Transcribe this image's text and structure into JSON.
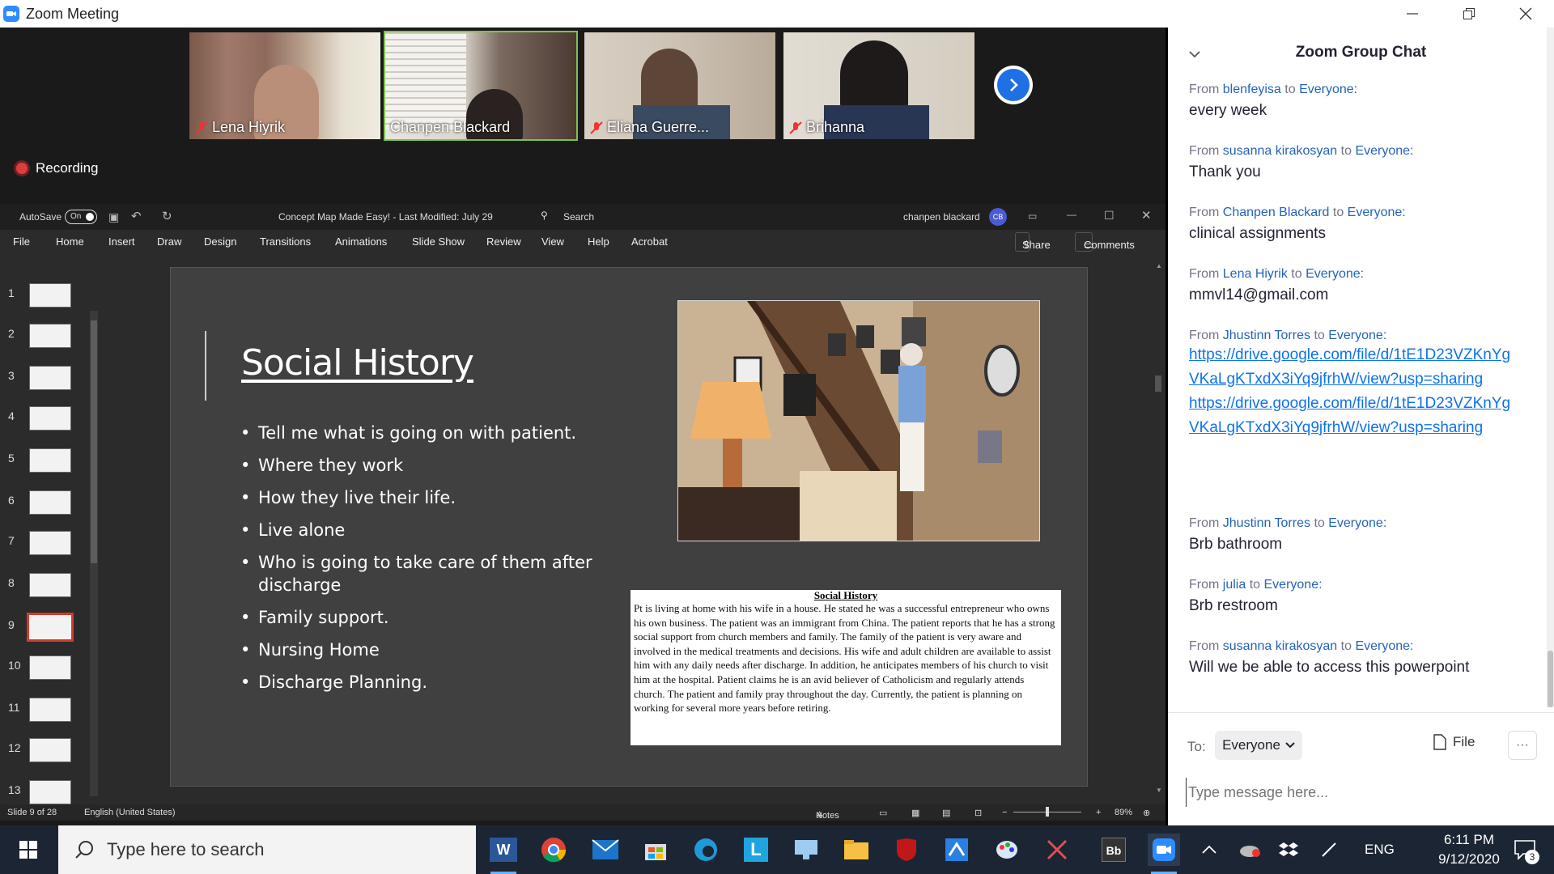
{
  "window": {
    "title": "Zoom Meeting"
  },
  "participants": [
    {
      "name": "Lena Hiyrik",
      "muted": true
    },
    {
      "name": "Chanpen Blackard",
      "muted": false,
      "active": true
    },
    {
      "name": "Eliana Guerre...",
      "muted": true
    },
    {
      "name": "Brihanna",
      "muted": true
    }
  ],
  "recording": "Recording",
  "ppt": {
    "autosave": "AutoSave",
    "autosave_state": "On",
    "doc_title": "Concept Map Made Easy!  -  Last Modified: July 29",
    "search": "Search",
    "user": "chanpen blackard",
    "user_initials": "CB",
    "menu": [
      "File",
      "Home",
      "Insert",
      "Draw",
      "Design",
      "Transitions",
      "Animations",
      "Slide Show",
      "Review",
      "View",
      "Help",
      "Acrobat"
    ],
    "share": "Share",
    "comments": "Comments",
    "slide_numbers": [
      "1",
      "2",
      "3",
      "4",
      "5",
      "6",
      "7",
      "8",
      "9",
      "10",
      "11",
      "12",
      "13"
    ],
    "selected_slide": 9,
    "slide": {
      "title": "Social History",
      "bullets": [
        "Tell me what is going on with patient.",
        "Where they work",
        "How they live their life.",
        "Live alone",
        "Who is going to take care of them after discharge",
        "Family support.",
        "Nursing Home",
        "Discharge Planning."
      ],
      "textbox_title": "Social History",
      "textbox_body": "Pt is living at home with his wife in a house.  He stated he was a successful entrepreneur who owns his own business.  The patient was an immigrant from China.  The patient reports that he has a strong social support from church members and family.  The family of the patient is very aware and involved in the medical treatments and decisions.  His wife and adult children are available to assist him with any daily needs after discharge.  In addition, he anticipates members of his church to visit him at the hospital. Patient claims he is an avid believer of Catholicism and regularly attends church.  The patient and family pray throughout the day.  Currently, the patient is planning on working for several more years before retiring."
    },
    "status": {
      "slide": "Slide 9 of 28",
      "language": "English (United States)",
      "notes": "Notes",
      "zoom": "89%"
    }
  },
  "chat": {
    "header": "Zoom Group Chat",
    "messages": [
      {
        "from": "blenfeyisa",
        "to": "Everyone:",
        "text": "every week"
      },
      {
        "from": "susanna kirakosyan",
        "to": "Everyone:",
        "text": "Thank you"
      },
      {
        "from": "Chanpen Blackard",
        "to": "Everyone:",
        "text": "clinical assignments"
      },
      {
        "from": "Lena Hiyrik",
        "to": "Everyone:",
        "text": "mmvl14@gmail.com"
      },
      {
        "from": "Jhustinn Torres",
        "to": "Everyone:",
        "link1": "https://drive.google.com/file/d/1tE1D23VZKnYgVKaLgKTxdX3iYq9jfrhW/view?usp=sharing",
        "link2": "https://drive.google.com/file/d/1tE1D23VZKnYgVKaLgKTxdX3iYq9jfrhW/view?usp=sharing"
      },
      {
        "from": "Jhustinn Torres",
        "to": "Everyone:",
        "text": "Brb bathroom"
      },
      {
        "from": "julia",
        "to": "Everyone:",
        "text": "Brb restroom"
      },
      {
        "from": "susanna kirakosyan",
        "to": "Everyone:",
        "text": "Will we be able to access this powerpoint"
      }
    ],
    "from_word": "From",
    "to_word": "to",
    "to_label": "To:",
    "recipient": "Everyone",
    "file": "File",
    "input_placeholder": "Type message here..."
  },
  "taskbar": {
    "search_placeholder": "Type here to search",
    "lang": "ENG",
    "time": "6:11 PM",
    "date": "9/12/2020",
    "notifications": "3"
  }
}
